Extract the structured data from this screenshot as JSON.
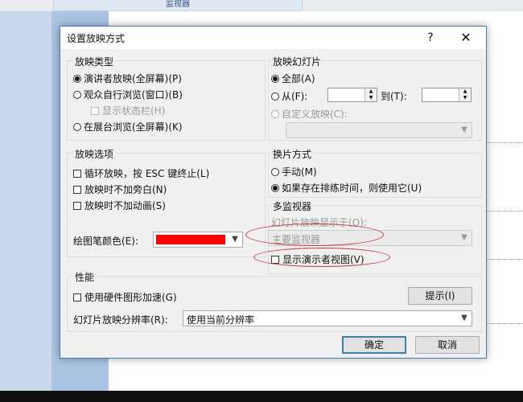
{
  "background": {
    "ribbon_button_label": "监视器"
  },
  "dialog": {
    "title": "设置放映方式",
    "help": "?",
    "close": "✕",
    "show_type": {
      "title": "放映类型",
      "options": [
        "演讲者放映(全屏幕)(P)",
        "观众自行浏览(窗口)(B)",
        "在展台浏览(全屏幕)(K)"
      ],
      "show_status_bar": "显示状态栏(H)",
      "selected_index": 0
    },
    "show_slides": {
      "title": "放映幻灯片",
      "all": "全部(A)",
      "from": "从(F):",
      "to": "到(T):",
      "custom": "自定义放映(C):",
      "selected": "all"
    },
    "show_options": {
      "title": "放映选项",
      "options": [
        "循环放映，按 ESC 键终止(L)",
        "放映时不加旁白(N)",
        "放映时不加动画(S)"
      ],
      "pen_color_label": "绘图笔颜色(E):",
      "pen_color": "#ff0000"
    },
    "advance": {
      "title": "换片方式",
      "options": [
        "手动(M)",
        "如果存在排练时间，则使用它(U)"
      ],
      "selected_index": 1
    },
    "multi_monitor": {
      "title": "多监视器",
      "show_on_label": "幻灯片放映显示于(O):",
      "show_on_value": "主要监视器",
      "presenter_view": "显示演示者视图(V)"
    },
    "performance": {
      "title": "性能",
      "hw_accel": "使用硬件图形加速(G)",
      "tips_button": "提示(I)",
      "resolution_label": "幻灯片放映分辨率(R):",
      "resolution_value": "使用当前分辨率"
    },
    "ok": "确定",
    "cancel": "取消"
  },
  "colors": {
    "accent": "#3c7fb1",
    "annotation": "#c8323c"
  }
}
